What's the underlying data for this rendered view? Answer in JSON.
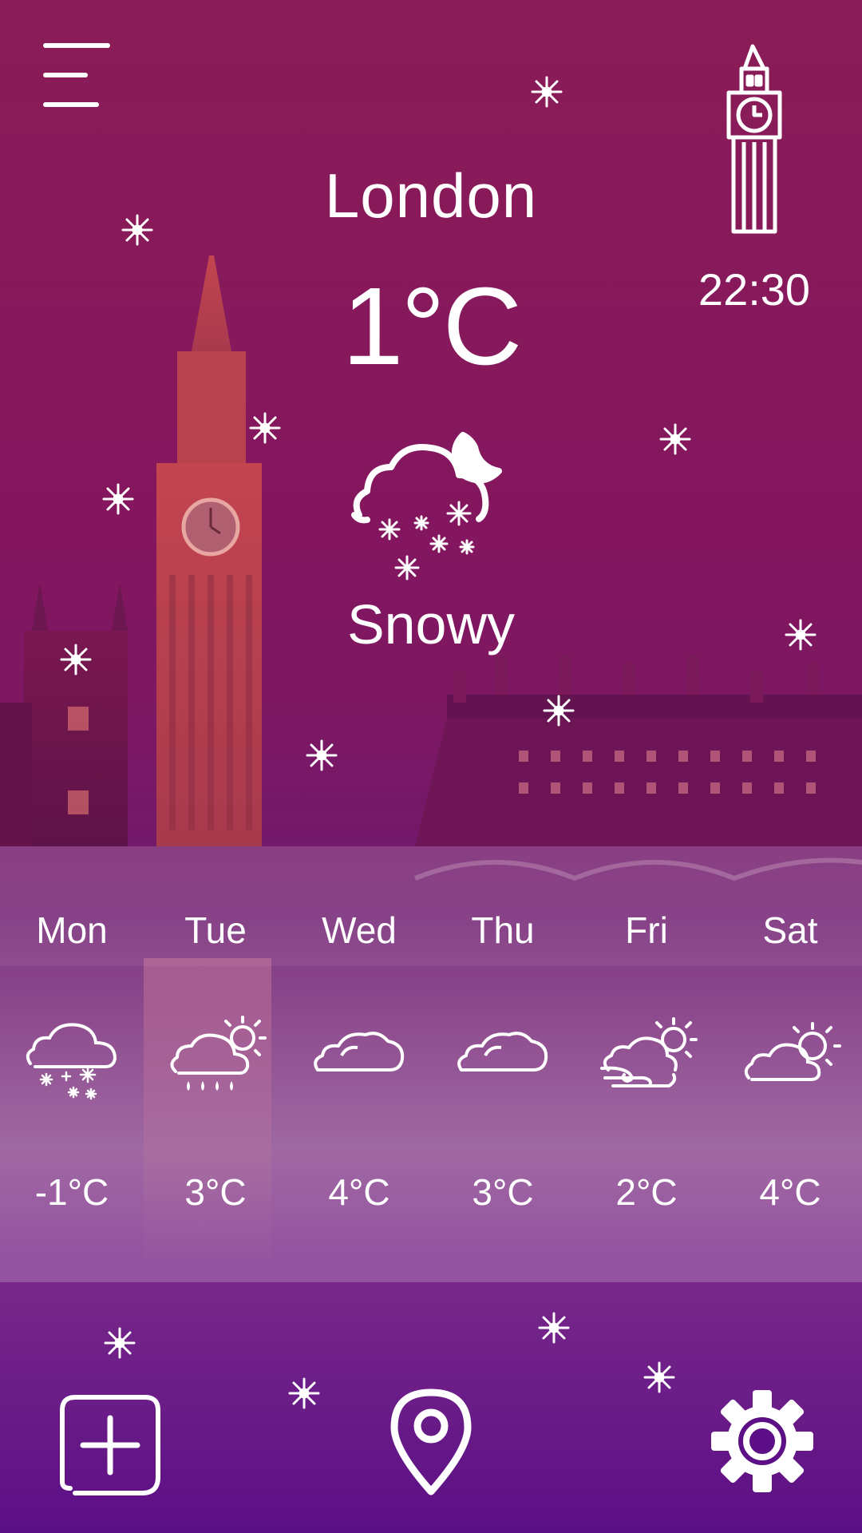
{
  "header": {
    "city": "London",
    "temperature": "1°C",
    "condition": "Snowy",
    "time": "22:30"
  },
  "icons": {
    "menu": "hamburger-menu-icon",
    "landmark": "big-ben-clock-tower-icon",
    "current_weather": "cloud-moon-snow-icon",
    "add": "add-location-icon",
    "location": "map-pin-icon",
    "settings": "gear-icon"
  },
  "forecast": [
    {
      "day": "Mon",
      "temp": "-1°C",
      "icon": "cloud-snow-icon"
    },
    {
      "day": "Tue",
      "temp": "3°C",
      "icon": "cloud-rain-sun-icon"
    },
    {
      "day": "Wed",
      "temp": "4°C",
      "icon": "cloud-icon"
    },
    {
      "day": "Thu",
      "temp": "3°C",
      "icon": "cloud-icon"
    },
    {
      "day": "Fri",
      "temp": "2°C",
      "icon": "cloud-wind-sun-icon"
    },
    {
      "day": "Sat",
      "temp": "4°C",
      "icon": "cloud-sun-icon"
    }
  ],
  "colors": {
    "accent_top": "#8a1d57",
    "accent_bottom": "#5c0f86",
    "text": "#ffffff"
  }
}
